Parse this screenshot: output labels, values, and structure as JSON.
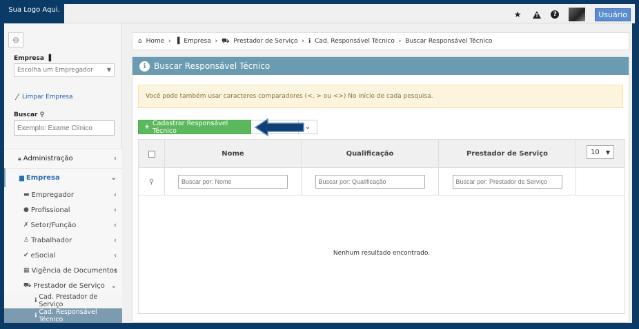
{
  "header": {
    "logo_text": "Sua Logo Aqui.",
    "user_label": "Usuário",
    "icons": [
      "star-icon",
      "warning-icon",
      "help-icon",
      "avatar"
    ]
  },
  "sidebar": {
    "empresa_label": "Empresa",
    "empresa_select_placeholder": "Escolha um Empregador",
    "clear_label": "Limpar Empresa",
    "buscar_label": "Buscar",
    "search_placeholder": "Exemplo: Exame Clínico",
    "menu": [
      {
        "label": "Administração",
        "icon": "lock-icon"
      },
      {
        "label": "Empresa",
        "icon": "building-icon",
        "active": true
      }
    ],
    "submenu": [
      {
        "label": "Empregador",
        "icon": "briefcase-icon"
      },
      {
        "label": "Profissional",
        "icon": "user-icon"
      },
      {
        "label": "Setor/Função",
        "icon": "wrench-icon"
      },
      {
        "label": "Trabalhador",
        "icon": "person-icon"
      },
      {
        "label": "eSocial",
        "icon": "check-icon"
      },
      {
        "label": "Vigência de Documentos",
        "icon": "calendar-icon"
      },
      {
        "label": "Prestador de Serviço",
        "icon": "car-icon",
        "expanded": true
      }
    ],
    "subsubmenu": [
      {
        "label": "Cad. Prestador de Serviço"
      },
      {
        "label": "Cad. Responsável Técnico",
        "current": true
      }
    ]
  },
  "breadcrumb": [
    "Home",
    "Empresa",
    "Prestador de Serviço",
    "Cad. Responsável Técnico",
    "Buscar Responsável Técnico"
  ],
  "panel": {
    "title": "Buscar Responsável Técnico",
    "alert": "Você pode também usar caracteres comparadores (<, > ou <>) No início de cada pesquisa.",
    "add_button": "Cadastrar Responsável Técnico",
    "page_size": "10"
  },
  "table": {
    "columns": [
      "Nome",
      "Qualificação",
      "Prestador de Serviço"
    ],
    "filters": [
      "Buscar por: Nome",
      "Buscar por: Qualificação",
      "Buscar por: Prestador de Serviço"
    ],
    "empty_message": "Nenhum resultado encontrado."
  },
  "colors": {
    "brand": "#0b3a66",
    "panel_header": "#6a9bb0",
    "add_button": "#5cb85c",
    "alert_bg": "#fcf4dd"
  }
}
